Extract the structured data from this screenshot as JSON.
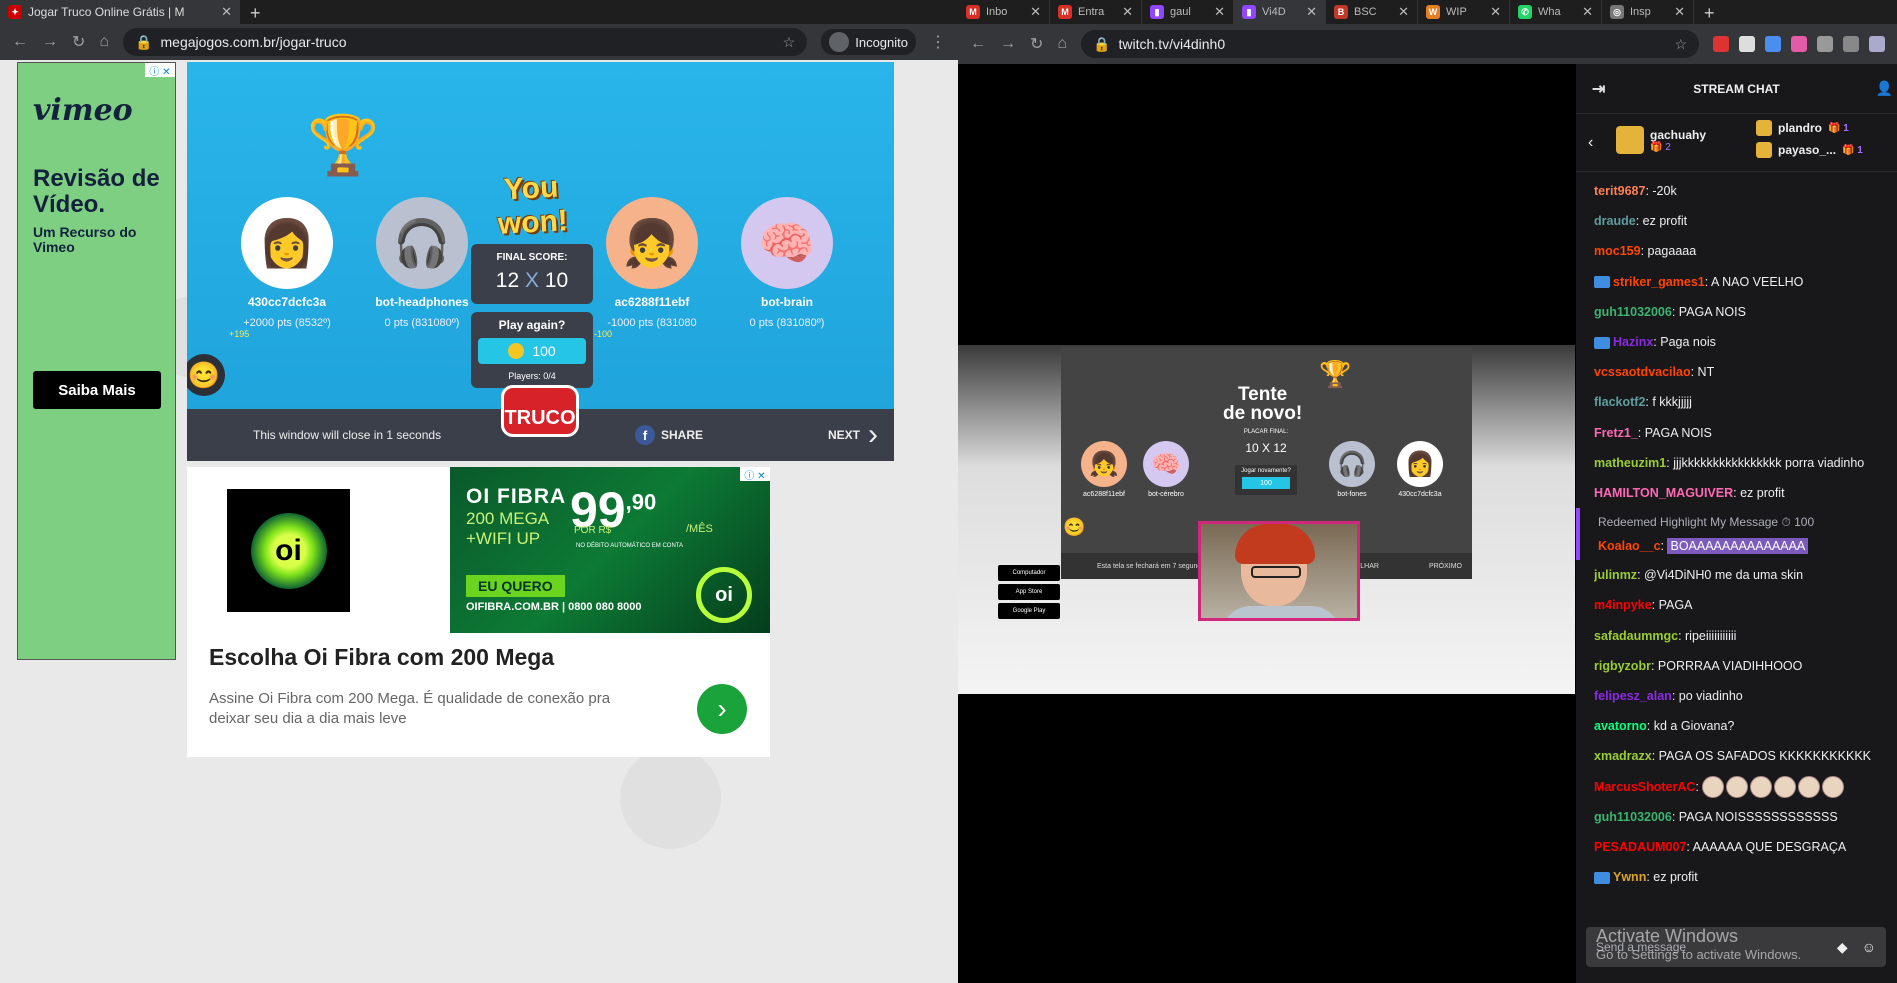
{
  "left_browser": {
    "tab_title": "Jogar Truco Online Grátis | M",
    "new_tab": "+",
    "url": "megajogos.com.br/jogar-truco",
    "incognito_label": "Incognito",
    "vimeo_ad": {
      "logo": "vimeo",
      "headline": "Revisão de Vídeo.",
      "sub": "Um Recurso do Vimeo",
      "button": "Saiba Mais"
    },
    "game": {
      "won_title": "You won!",
      "final_score_label": "FINAL SCORE:",
      "score_left": "12",
      "score_x": "X",
      "score_right": "10",
      "play_again_label": "Play again?",
      "play_again_value": "100",
      "players": "Players: 0/4",
      "players_list": [
        {
          "name": "430cc7dcfc3a",
          "pts": "+2000 pts (8532º)",
          "coins": "+195"
        },
        {
          "name": "bot-headphones",
          "pts": "0 pts (831080º)",
          "coins": ""
        },
        {
          "name": "ac6288f11ebf",
          "pts": "-1000 pts (831080",
          "coins": "-100"
        },
        {
          "name": "bot-brain",
          "pts": "0 pts (831080º)",
          "coins": ""
        }
      ],
      "close_text": "This window will close in 1 seconds",
      "logo": "TRUCO",
      "share": "SHARE",
      "next": "NEXT"
    },
    "oi_ad": {
      "logo": "oi",
      "banner_line1": "OI FIBRA",
      "banner_line2": "200 MEGA",
      "banner_line3": "+WIFI UP",
      "por": "POR R$",
      "price": "99",
      "cents": ",90",
      "per": "/MÊS",
      "fine": "NO DÉBITO AUTOMÁTICO EM CONTA",
      "cta": "EU QUERO",
      "site": "OIFIBRA.COM.BR | 0800 080 8000",
      "title": "Escolha Oi Fibra com 200 Mega",
      "desc": "Assine Oi Fibra com 200 Mega. É qualidade de conexão pra deixar seu dia a dia mais leve"
    }
  },
  "right_browser": {
    "tabs": [
      "Inbo",
      "Entra",
      "gaul",
      "Vi4D",
      "BSC",
      "WIP",
      "Wha",
      "Insp"
    ],
    "url": "twitch.tv/vi4dinh0",
    "stream": {
      "title_line1": "Tente",
      "title_line2": "de novo!",
      "placar": "PLACAR FINAL:",
      "score": "10 X 12",
      "again": "Jogar novamente?",
      "again_value": "100",
      "players_mini": [
        "ac6288f11ebf",
        "bot-cérebro",
        "bot-fones",
        "430cc7dcfc3a"
      ],
      "foot": "Esta tela se fechará em 7 segundos",
      "share": "TILHAR",
      "next": "PRÓXIMO",
      "stores": [
        "Computador",
        "App Store",
        "Google Play"
      ]
    },
    "chat": {
      "header": "STREAM CHAT",
      "gift_main_user": "gachuahy",
      "gift_main_count": "2",
      "gift_users": [
        {
          "name": "plandro",
          "count": "1"
        },
        {
          "name": "payaso_...",
          "count": "1"
        }
      ],
      "messages": [
        {
          "user": "terit9687",
          "color": "#ff7f50",
          "text": "-20k",
          "badge": false
        },
        {
          "user": "draude",
          "color": "#5f9ea0",
          "text": "ez profit",
          "badge": false
        },
        {
          "user": "moc159",
          "color": "#ff4500",
          "text": "pagaaaa",
          "badge": false
        },
        {
          "user": "striker_games1",
          "color": "#ff4500",
          "text": "A NAO VEELHO",
          "badge": true
        },
        {
          "user": "guh11032006",
          "color": "#3cb371",
          "text": "PAGA NOIS",
          "badge": false
        },
        {
          "user": "Hazinx",
          "color": "#8a2be2",
          "text": "Paga nois",
          "badge": true
        },
        {
          "user": "vcssaotdvacilao",
          "color": "#ff4500",
          "text": "NT",
          "badge": false
        },
        {
          "user": "flackotf2",
          "color": "#5f9ea0",
          "text": "f kkkjjjjj",
          "badge": false
        },
        {
          "user": "Fretz1_",
          "color": "#ff69b4",
          "text": "PAGA NOIS",
          "badge": false
        },
        {
          "user": "matheuzim1",
          "color": "#9acd32",
          "text": "jjjkkkkkkkkkkkkkkkk porra viadinho",
          "badge": false
        },
        {
          "user": "HAMILTON_MAGUIVER",
          "color": "#ff69b4",
          "text": "ez profit",
          "badge": false
        }
      ],
      "redeem_title": "Redeemed Highlight My Message",
      "redeem_cost": "100",
      "redeem_user": "Koalao__c",
      "redeem_text": "BOAAAAAAAAAAAAAA",
      "messages2": [
        {
          "user": "julinmz",
          "color": "#9acd32",
          "text": "@Vi4DiNH0 me da uma skin",
          "badge": false
        },
        {
          "user": "m4inpyke",
          "color": "#ff0000",
          "text": "PAGA",
          "badge": false
        },
        {
          "user": "safadaummgc",
          "color": "#9acd32",
          "text": "ripeiiiiiiiiiii",
          "badge": false
        },
        {
          "user": "rigbyzobr",
          "color": "#9acd32",
          "text": "PORRRAA VIADIHHOOO",
          "badge": false
        },
        {
          "user": "felipesz_alan",
          "color": "#8a2be2",
          "text": "po viadinho",
          "badge": false
        },
        {
          "user": "avatorno",
          "color": "#00ff7f",
          "text": "kd a Giovana?",
          "badge": false
        },
        {
          "user": "xmadrazx",
          "color": "#9acd32",
          "text": "PAGA OS SAFADOS KKKKKKKKKKK",
          "badge": false
        },
        {
          "user": "MarcusShoterAC",
          "color": "#ff0000",
          "text": "",
          "badge": false,
          "emotes": 6
        },
        {
          "user": "guh11032006",
          "color": "#3cb371",
          "text": "PAGA NOISSSSSSSSSSSS",
          "badge": false
        },
        {
          "user": "PESADAUM007",
          "color": "#ff0000",
          "text": "AAAAAA QUE DESGRAÇA",
          "badge": false
        },
        {
          "user": "Ywnn",
          "color": "#daa520",
          "text": "ez profit",
          "badge": true
        }
      ],
      "input_placeholder": "Send a message"
    },
    "watermark_line1": "Activate Windows",
    "watermark_line2": "Go to Settings to activate Windows."
  }
}
